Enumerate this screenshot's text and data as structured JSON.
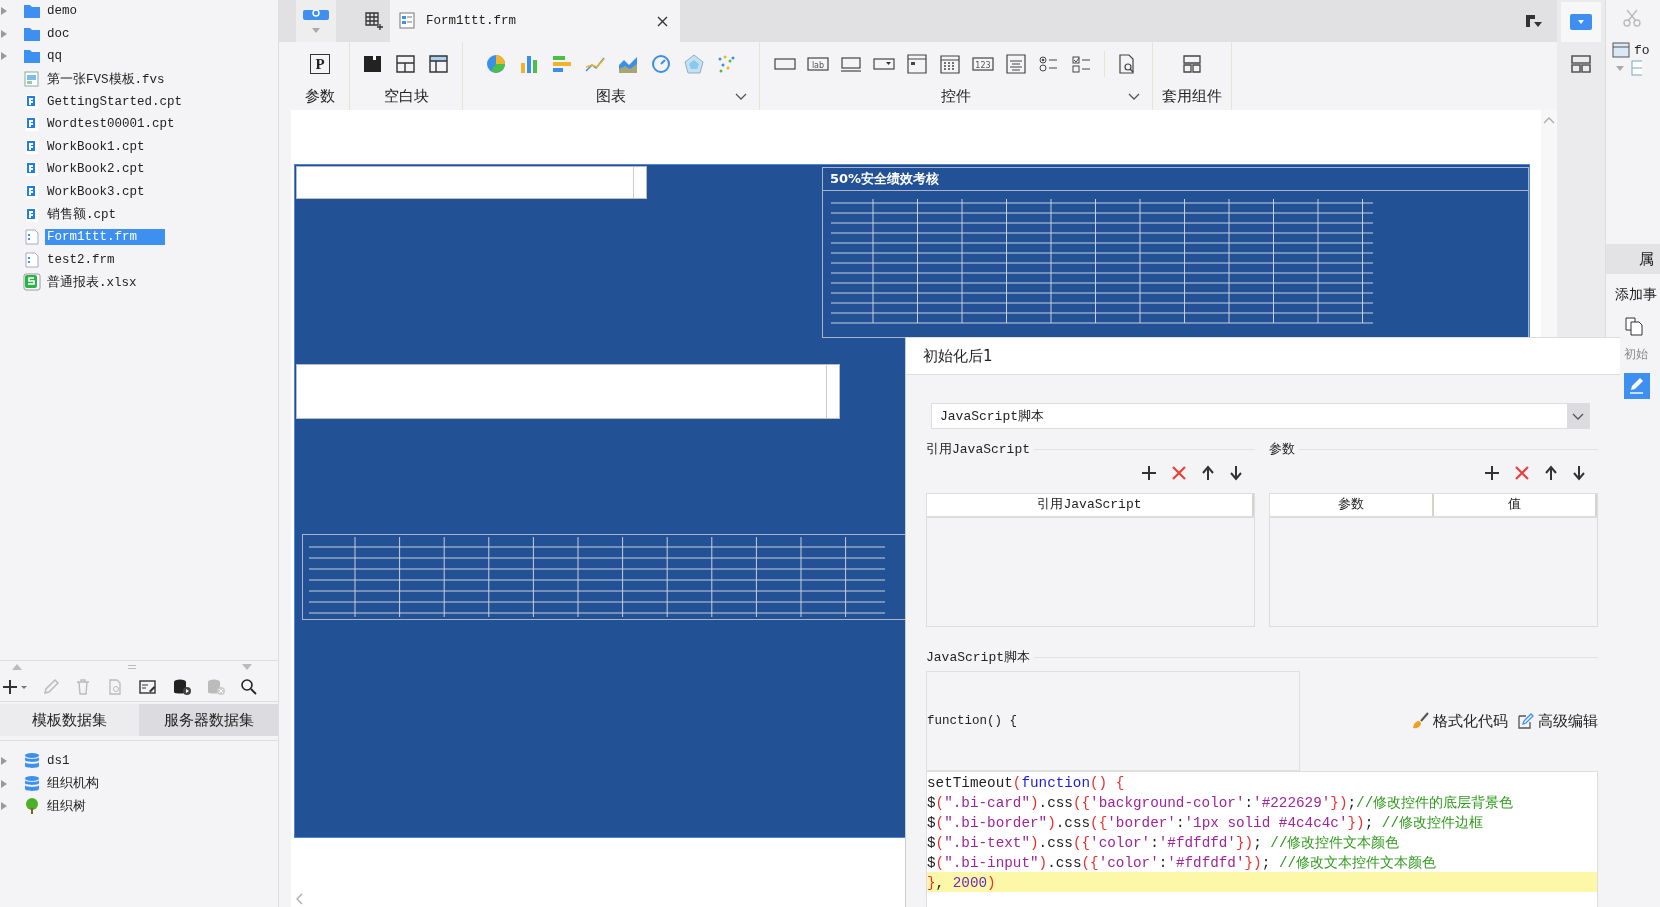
{
  "file_tree": [
    {
      "label": "demo",
      "kind": "folder",
      "selected": false
    },
    {
      "label": "doc",
      "kind": "folder",
      "selected": false
    },
    {
      "label": "qq",
      "kind": "folder",
      "selected": false
    },
    {
      "label": "第一张FVS模板.fvs",
      "kind": "fvs",
      "selected": false
    },
    {
      "label": "GettingStarted.cpt",
      "kind": "cpt",
      "selected": false
    },
    {
      "label": "Wordtest00001.cpt",
      "kind": "cpt",
      "selected": false
    },
    {
      "label": "WorkBook1.cpt",
      "kind": "cpt",
      "selected": false
    },
    {
      "label": "WorkBook2.cpt",
      "kind": "cpt",
      "selected": false
    },
    {
      "label": "WorkBook3.cpt",
      "kind": "cpt",
      "selected": false
    },
    {
      "label": "销售额.cpt",
      "kind": "cpt",
      "selected": false
    },
    {
      "label": "Form1ttt.frm",
      "kind": "frm",
      "selected": true
    },
    {
      "label": "test2.frm",
      "kind": "frm",
      "selected": false
    },
    {
      "label": "普通报表.xlsx",
      "kind": "xlsx",
      "selected": false
    }
  ],
  "dataset_tabs": [
    {
      "label": "模板数据集",
      "selected": true
    },
    {
      "label": "服务器数据集",
      "selected": false
    }
  ],
  "datasets": [
    {
      "label": "ds1",
      "kind": "db"
    },
    {
      "label": "组织机构",
      "kind": "db"
    },
    {
      "label": "组织树",
      "kind": "tree"
    }
  ],
  "document_tab": {
    "label": "Form1ttt.frm"
  },
  "toolbar_groups": [
    {
      "kind": "param",
      "label": "参数",
      "glyph": "P",
      "menu": false
    },
    {
      "kind": "block",
      "label": "空白块",
      "menu": false
    },
    {
      "kind": "chart",
      "label": "图表",
      "menu": true
    },
    {
      "kind": "widget",
      "label": "控件",
      "menu": true,
      "icon_texts": [
        "lab",
        "123"
      ]
    },
    {
      "kind": "component",
      "label": "套用组件",
      "menu": false
    }
  ],
  "form": {
    "chart_table_title": "50%安全绩效考核"
  },
  "side_panel": {
    "top_item": "fo",
    "tab": "属",
    "heading": "添加事",
    "event": "初始"
  },
  "event_dialog": {
    "title": "初始化后1",
    "type_select": "JavaScript脚本",
    "refs_label": "引用JavaScript",
    "refs_column": "引用JavaScript",
    "params_label": "参数",
    "params_columns": [
      "参数",
      "值"
    ],
    "script_label": "JavaScript脚本",
    "function_header": "function() {",
    "actions": [
      "格式化代码",
      "高级编辑"
    ],
    "code_lines": [
      {
        "current": false,
        "tokens": [
          {
            "kind": "plain",
            "text": "setTimeout"
          },
          {
            "kind": "bracket",
            "text": "("
          },
          {
            "kind": "keyword",
            "text": "function"
          },
          {
            "kind": "bracket",
            "text": "() {"
          }
        ]
      },
      {
        "current": false,
        "tokens": [
          {
            "kind": "plain",
            "text": "$"
          },
          {
            "kind": "bracket",
            "text": "("
          },
          {
            "kind": "string",
            "text": "\".bi-card\""
          },
          {
            "kind": "bracket",
            "text": ")"
          },
          {
            "kind": "plain",
            "text": ".css"
          },
          {
            "kind": "bracket",
            "text": "({"
          },
          {
            "kind": "string",
            "text": "'background-color'"
          },
          {
            "kind": "plain",
            "text": ":"
          },
          {
            "kind": "string",
            "text": "'#222629'"
          },
          {
            "kind": "bracket",
            "text": "})"
          },
          {
            "kind": "plain",
            "text": ";"
          },
          {
            "kind": "comment",
            "text": "//修改控件的底层背景色"
          }
        ]
      },
      {
        "current": false,
        "tokens": [
          {
            "kind": "plain",
            "text": "$"
          },
          {
            "kind": "bracket",
            "text": "("
          },
          {
            "kind": "string",
            "text": "\".bi-border\""
          },
          {
            "kind": "bracket",
            "text": ")"
          },
          {
            "kind": "plain",
            "text": ".css"
          },
          {
            "kind": "bracket",
            "text": "({"
          },
          {
            "kind": "string",
            "text": "'border'"
          },
          {
            "kind": "plain",
            "text": ":"
          },
          {
            "kind": "string",
            "text": "'1px solid #4c4c4c'"
          },
          {
            "kind": "bracket",
            "text": "})"
          },
          {
            "kind": "plain",
            "text": "; "
          },
          {
            "kind": "comment",
            "text": "//修改控件边框"
          }
        ]
      },
      {
        "current": false,
        "tokens": [
          {
            "kind": "plain",
            "text": "$"
          },
          {
            "kind": "bracket",
            "text": "("
          },
          {
            "kind": "string",
            "text": "\".bi-text\""
          },
          {
            "kind": "bracket",
            "text": ")"
          },
          {
            "kind": "plain",
            "text": ".css"
          },
          {
            "kind": "bracket",
            "text": "({"
          },
          {
            "kind": "string",
            "text": "'color'"
          },
          {
            "kind": "plain",
            "text": ":"
          },
          {
            "kind": "string",
            "text": "'#fdfdfd'"
          },
          {
            "kind": "bracket",
            "text": "})"
          },
          {
            "kind": "plain",
            "text": "; "
          },
          {
            "kind": "comment",
            "text": "//修改控件文本颜色"
          }
        ]
      },
      {
        "current": false,
        "tokens": [
          {
            "kind": "plain",
            "text": "$"
          },
          {
            "kind": "bracket",
            "text": "("
          },
          {
            "kind": "string",
            "text": "\".bi-input\""
          },
          {
            "kind": "bracket",
            "text": ")"
          },
          {
            "kind": "plain",
            "text": ".css"
          },
          {
            "kind": "bracket",
            "text": "({"
          },
          {
            "kind": "string",
            "text": "'color'"
          },
          {
            "kind": "plain",
            "text": ":"
          },
          {
            "kind": "string",
            "text": "'#fdfdfd'"
          },
          {
            "kind": "bracket",
            "text": "})"
          },
          {
            "kind": "plain",
            "text": "; "
          },
          {
            "kind": "comment",
            "text": "//修改文本控件文本颜色"
          }
        ]
      },
      {
        "current": true,
        "tokens": [
          {
            "kind": "bracket",
            "text": "}"
          },
          {
            "kind": "plain",
            "text": ", "
          },
          {
            "kind": "number",
            "text": "2000"
          },
          {
            "kind": "bracket",
            "text": ")"
          }
        ]
      }
    ]
  }
}
